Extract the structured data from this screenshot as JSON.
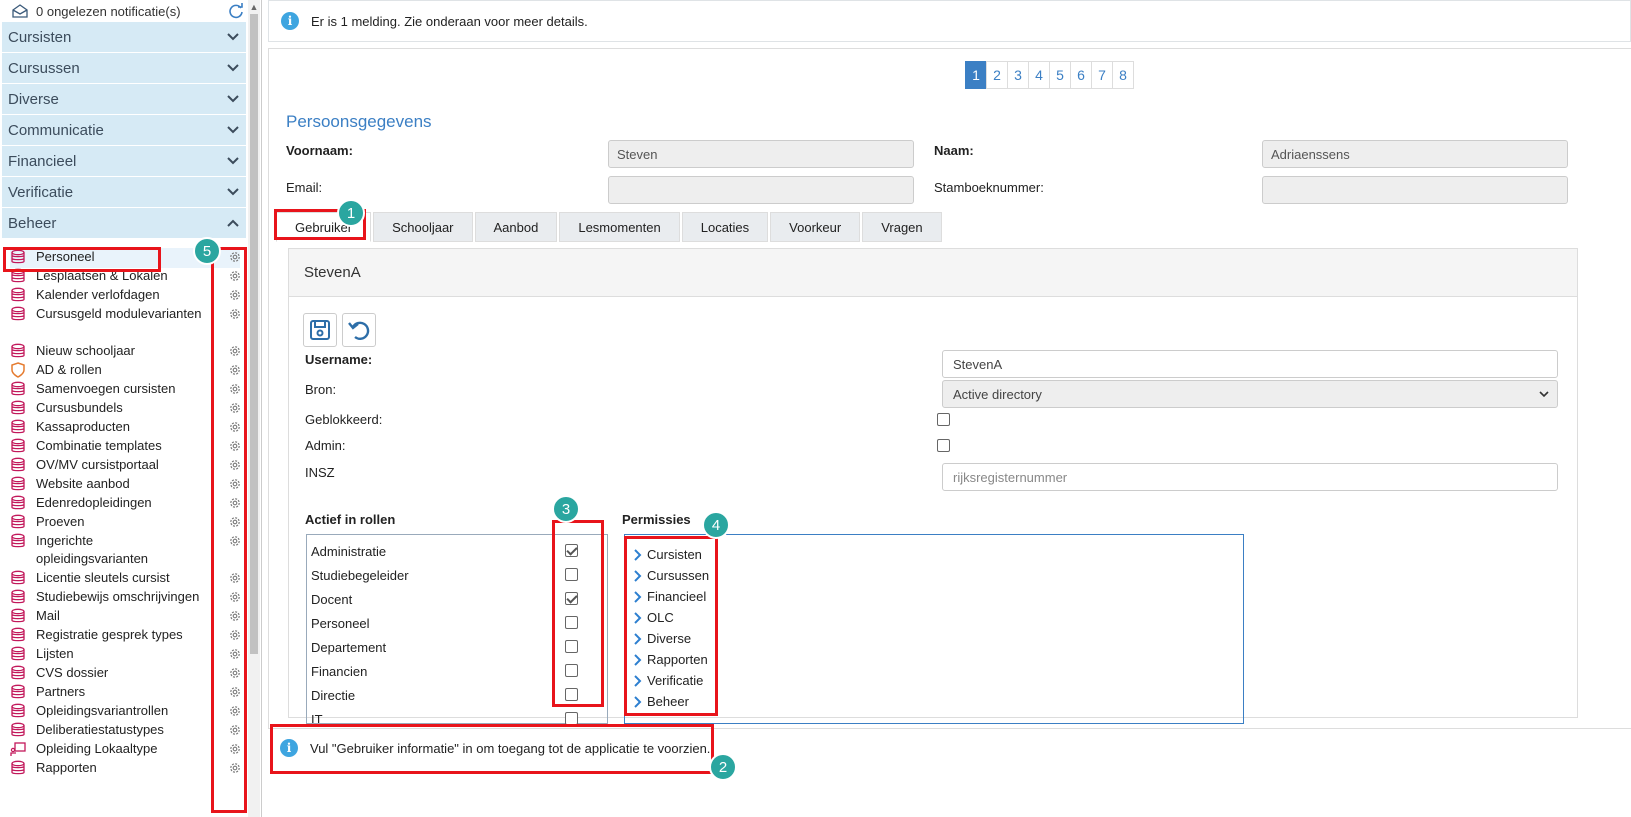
{
  "notifications": {
    "text": "0 ongelezen notificatie(s)"
  },
  "sidebar": {
    "sections": [
      {
        "label": "Cursisten"
      },
      {
        "label": "Cursussen"
      },
      {
        "label": "Diverse"
      },
      {
        "label": "Communicatie"
      },
      {
        "label": "Financieel"
      },
      {
        "label": "Verificatie"
      },
      {
        "label": "Beheer"
      }
    ],
    "items": [
      {
        "label": "Personeel",
        "icon": "database-icon"
      },
      {
        "label": "Lesplaatsen & Lokalen",
        "icon": "database-icon"
      },
      {
        "label": "Kalender verlofdagen",
        "icon": "database-icon"
      },
      {
        "label": "Cursusgeld modulevarianten",
        "icon": "database-icon"
      },
      {
        "label": "Nieuw schooljaar",
        "icon": "database-icon"
      },
      {
        "label": "AD & rollen",
        "icon": "shield-icon"
      },
      {
        "label": "Samenvoegen cursisten",
        "icon": "database-icon"
      },
      {
        "label": "Cursusbundels",
        "icon": "database-icon"
      },
      {
        "label": "Kassaproducten",
        "icon": "database-icon"
      },
      {
        "label": "Combinatie templates",
        "icon": "database-icon"
      },
      {
        "label": "OV/MV cursistportaal",
        "icon": "database-icon"
      },
      {
        "label": "Website aanbod",
        "icon": "database-icon"
      },
      {
        "label": "Edenredopleidingen",
        "icon": "database-icon"
      },
      {
        "label": "Proeven",
        "icon": "database-icon"
      },
      {
        "label": "Ingerichte opleidingsvarianten",
        "icon": "database-icon"
      },
      {
        "label": "Licentie sleutels cursist",
        "icon": "database-icon"
      },
      {
        "label": "Studiebewijs omschrijvingen",
        "icon": "database-icon"
      },
      {
        "label": "Mail",
        "icon": "database-icon"
      },
      {
        "label": "Registratie gesprek types",
        "icon": "database-icon"
      },
      {
        "label": "Lijsten",
        "icon": "database-icon"
      },
      {
        "label": "CVS dossier",
        "icon": "database-icon"
      },
      {
        "label": "Partners",
        "icon": "database-icon"
      },
      {
        "label": "Opleidingsvariantrollen",
        "icon": "database-icon"
      },
      {
        "label": "Deliberatiestatustypes",
        "icon": "database-icon"
      },
      {
        "label": "Opleiding Lokaaltype",
        "icon": "classroom-icon"
      },
      {
        "label": "Rapporten",
        "icon": "database-icon"
      }
    ]
  },
  "alert_top": {
    "text": "Er is 1 melding. Zie onderaan voor meer details."
  },
  "pagination": {
    "pages": [
      "1",
      "2",
      "3",
      "4",
      "5",
      "6",
      "7",
      "8"
    ],
    "current": "1"
  },
  "person": {
    "title": "Persoonsgegevens",
    "voornaam_label": "Voornaam:",
    "voornaam_value": "Steven",
    "naam_label": "Naam:",
    "naam_value": "Adriaenssens",
    "email_label": "Email:",
    "email_value": "",
    "stamboek_label": "Stamboeknummer:",
    "stamboek_value": ""
  },
  "tabs": [
    {
      "label": "Gebruiker"
    },
    {
      "label": "Schooljaar"
    },
    {
      "label": "Aanbod"
    },
    {
      "label": "Lesmomenten"
    },
    {
      "label": "Locaties"
    },
    {
      "label": "Voorkeur"
    },
    {
      "label": "Vragen"
    }
  ],
  "user_panel": {
    "header": "StevenA",
    "username_label": "Username:",
    "username_value": "StevenA",
    "bron_label": "Bron:",
    "bron_value": "Active directory",
    "geblokkeerd_label": "Geblokkeerd:",
    "geblokkeerd_checked": false,
    "admin_label": "Admin:",
    "admin_checked": false,
    "insz_label": "INSZ",
    "insz_placeholder": "rijksregisternummer"
  },
  "roles": {
    "title": "Actief in rollen",
    "items": [
      {
        "label": "Administratie",
        "checked": true
      },
      {
        "label": "Studiebegeleider",
        "checked": false
      },
      {
        "label": "Docent",
        "checked": true
      },
      {
        "label": "Personeel",
        "checked": false
      },
      {
        "label": "Departement",
        "checked": false
      },
      {
        "label": "Financien",
        "checked": false
      },
      {
        "label": "Directie",
        "checked": false
      },
      {
        "label": "IT",
        "checked": false
      }
    ]
  },
  "permissions": {
    "title": "Permissies",
    "items": [
      "Cursisten",
      "Cursussen",
      "Financieel",
      "OLC",
      "Diverse",
      "Rapporten",
      "Verificatie",
      "Beheer"
    ]
  },
  "alert_bottom": {
    "text": "Vul \"Gebruiker informatie\" in om toegang tot de applicatie te voorzien."
  },
  "annotations": [
    "1",
    "2",
    "3",
    "4",
    "5"
  ],
  "colors": {
    "accent": "#3b7fc4",
    "highlight": "#e8141b",
    "badge": "#2aa6a0",
    "section_bg": "#d6eaf5",
    "icon_pink": "#c2185b"
  }
}
